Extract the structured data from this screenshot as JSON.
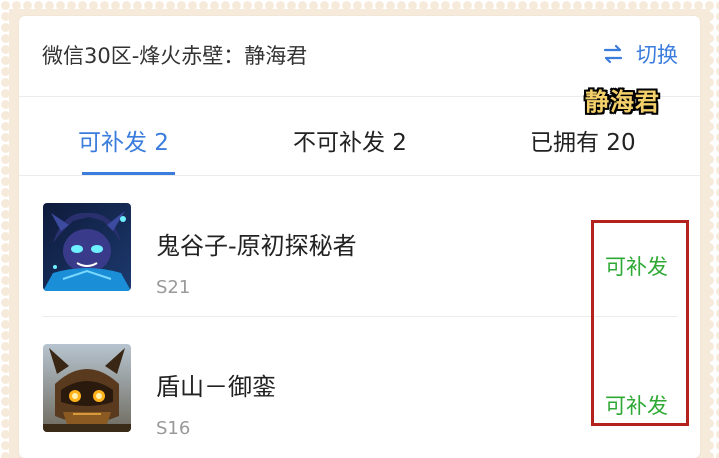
{
  "header": {
    "server_title": "微信30区-烽火赤壁：静海君",
    "switch_label": "切换",
    "switch_icon": "swap-arrows-icon"
  },
  "tabs": [
    {
      "label": "可补发 2",
      "active": true
    },
    {
      "label": "不可补发 2",
      "active": false
    },
    {
      "label": "已拥有 20",
      "active": false
    }
  ],
  "skins": [
    {
      "name": "鬼谷子-原初探秘者",
      "season": "S21",
      "status": "可补发",
      "avatar_icon": "hero-avatar-guiguzi"
    },
    {
      "name": "盾山－御銮",
      "season": "S16",
      "status": "可补发",
      "avatar_icon": "hero-avatar-dunshan"
    }
  ],
  "watermark": "静海君",
  "colors": {
    "accent": "#3b7ddd",
    "status_green": "#2fa935",
    "highlight_red": "#b3221d",
    "frame": "#f6eadb"
  }
}
